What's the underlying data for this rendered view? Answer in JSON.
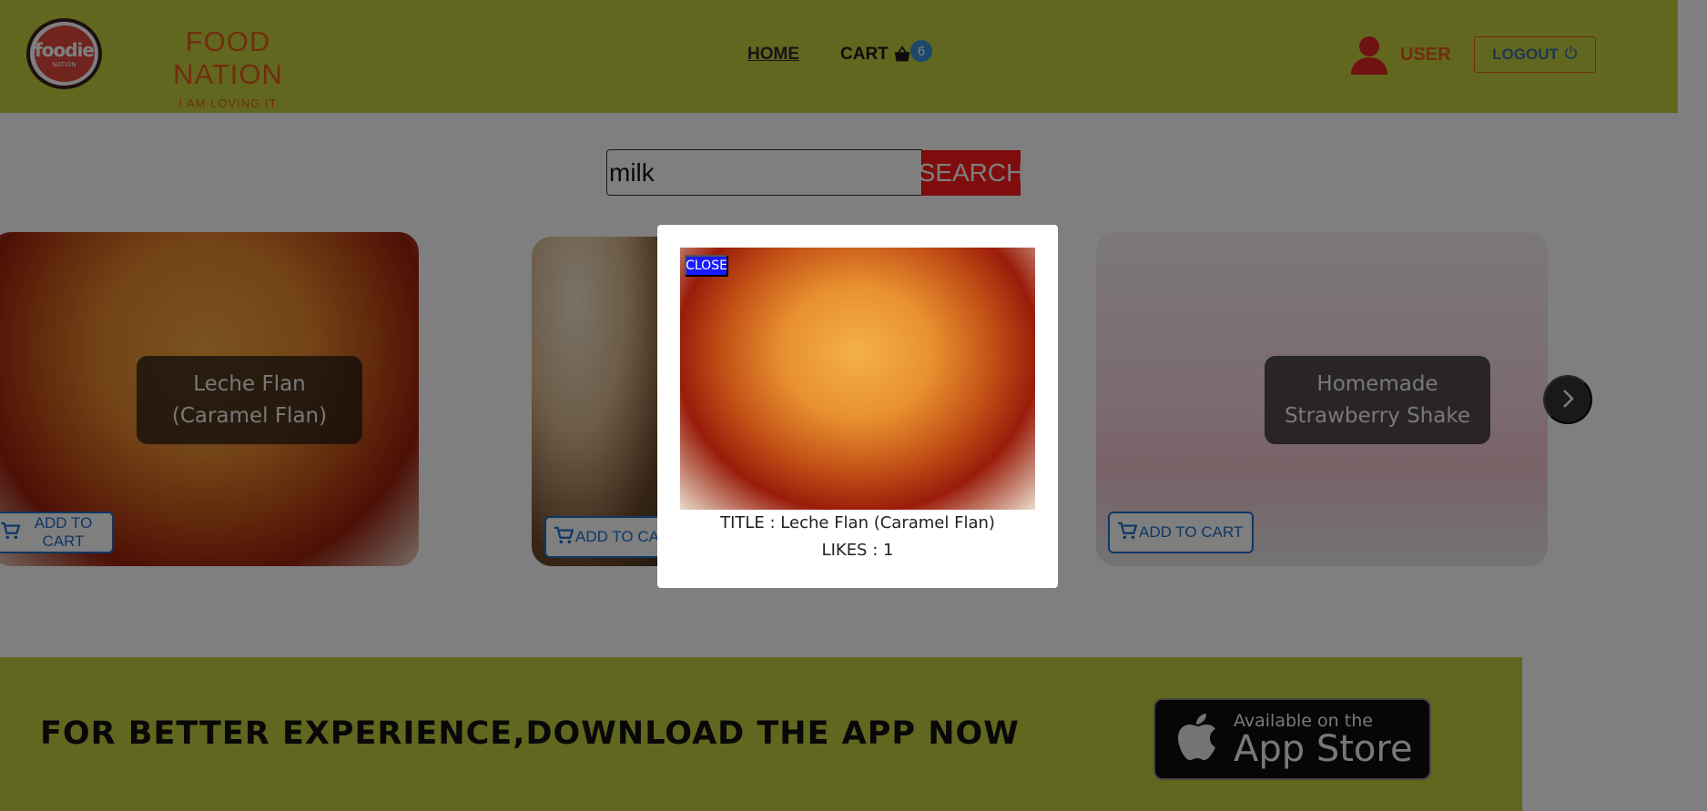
{
  "header": {
    "logo_word": "foodie",
    "logo_sub": "NATION",
    "brand_title": "FOOD NATION",
    "brand_tagline": "I AM LOVING IT",
    "nav_home": "HOME",
    "nav_cart": "CART",
    "cart_count": "6",
    "user_label": "USER",
    "logout_label": "LOGOUT"
  },
  "search": {
    "value": "milk",
    "button_label": "SEARCH"
  },
  "cards": [
    {
      "title": "Leche Flan (Caramel Flan)",
      "add_to_cart": "ADD TO CART"
    },
    {
      "title": "",
      "add_to_cart": "ADD TO CA"
    },
    {
      "title": "Homemade Strawberry Shake",
      "add_to_cart": "ADD TO CART"
    }
  ],
  "banner": {
    "text": "FOR BETTER EXPERIENCE,DOWNLOAD THE APP NOW",
    "app_store_small": "Available on the",
    "app_store_big": "App Store"
  },
  "modal": {
    "close_label": "CLOSE",
    "title_line": "TITLE : Leche Flan (Caramel Flan)",
    "likes_line": "LIKES : 1"
  },
  "colors": {
    "header_bg": "#c3cf3f",
    "brand": "#e35b1d",
    "search_button": "#ff1a1a",
    "add_to_cart": "#1b6ec8",
    "close_button": "#1a1aff",
    "cart_badge": "#3a8fd6"
  },
  "icons": {
    "cart": "shopping-basket-icon",
    "user": "user-icon",
    "logout": "power-icon",
    "add_to_cart": "shopping-cart-icon",
    "next": "chevron-right-icon",
    "app_store": "apple-icon"
  }
}
